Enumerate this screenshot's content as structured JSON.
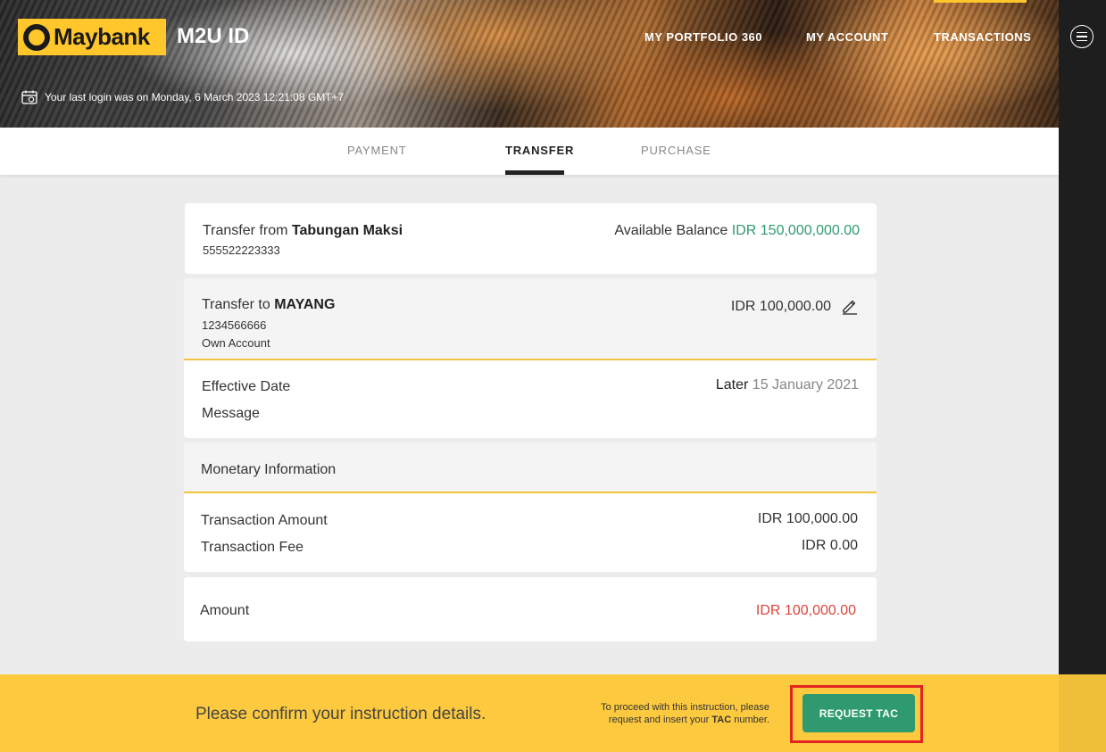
{
  "header": {
    "brand": "Maybank",
    "app_title": "M2U ID",
    "nav": [
      "MY PORTFOLIO 360",
      "MY ACCOUNT",
      "TRANSACTIONS"
    ],
    "last_login": "Your last login was on Monday, 6 March 2023 12:21:08 GMT+7",
    "icons": {
      "calendar": "calendar-icon",
      "menu": "hamburger-menu-icon",
      "edit": "pencil-edit-icon"
    }
  },
  "tabs": [
    {
      "label": "PAYMENT",
      "active": false
    },
    {
      "label": "TRANSFER",
      "active": true
    },
    {
      "label": "PURCHASE",
      "active": false
    }
  ],
  "from_card": {
    "prefix": "Transfer from",
    "account_name": "Tabungan Maksi",
    "account_number": "555522223333",
    "balance_label": "Available Balance",
    "balance_value": "IDR 150,000,000.00"
  },
  "to_card": {
    "prefix": "Transfer to",
    "recipient": "MAYANG",
    "account_number": "1234566666",
    "account_type": "Own Account",
    "amount": "IDR 100,000.00",
    "effective_date_label": "Effective Date",
    "effective_when": "Later",
    "effective_date": "15 January 2021",
    "message_label": "Message"
  },
  "monetary": {
    "title": "Monetary Information",
    "transaction_amount_label": "Transaction Amount",
    "transaction_amount": "IDR 100,000.00",
    "transaction_fee_label": "Transaction Fee",
    "transaction_fee": "IDR 0.00"
  },
  "total": {
    "label": "Amount",
    "value": "IDR 100,000.00"
  },
  "footer": {
    "confirm_message": "Please confirm your instruction details.",
    "tac_note_line1": "To proceed with this instruction, please",
    "tac_note_line2_pre": "request and insert your",
    "tac_note_bold": "TAC",
    "tac_note_post": "number.",
    "button_label": "REQUEST TAC"
  },
  "colors": {
    "brand_yellow": "#ffc72c",
    "footer_yellow": "#fdca3f",
    "accent_green": "#2f9a6f",
    "amount_red": "#d9453c",
    "highlight_red": "#e32420"
  }
}
